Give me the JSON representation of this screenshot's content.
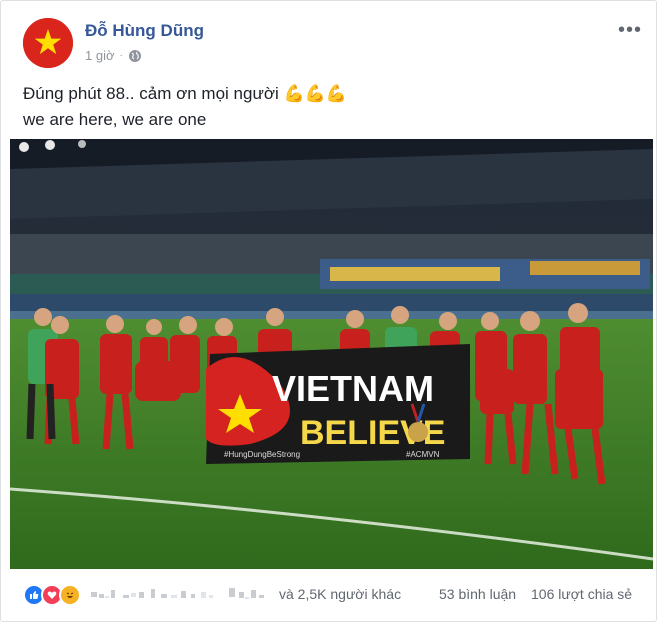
{
  "post": {
    "author": "Đỗ Hùng Dũng",
    "time": "1 giờ",
    "privacy_icon": "globe-icon",
    "more_icon": "more-options-icon",
    "text_line1": "Đúng phút 88.. cảm ơn mọi người",
    "emojis": "💪💪💪",
    "text_line2": "we are here, we are one"
  },
  "photo": {
    "banner_line1": "VIETNAM",
    "banner_line2": "BELIEVE",
    "banner_hashtag": "#ACMVN",
    "banner_small": "#HungDungBeStrong"
  },
  "footer": {
    "reactions": [
      "like-icon",
      "love-icon",
      "haha-icon"
    ],
    "others": "và 2,5K người khác",
    "comments": "53 bình luận",
    "shares": "106 lượt chia sẻ"
  },
  "colors": {
    "link": "#365899",
    "flag_red": "#da251d",
    "flag_star": "#ffde00"
  }
}
